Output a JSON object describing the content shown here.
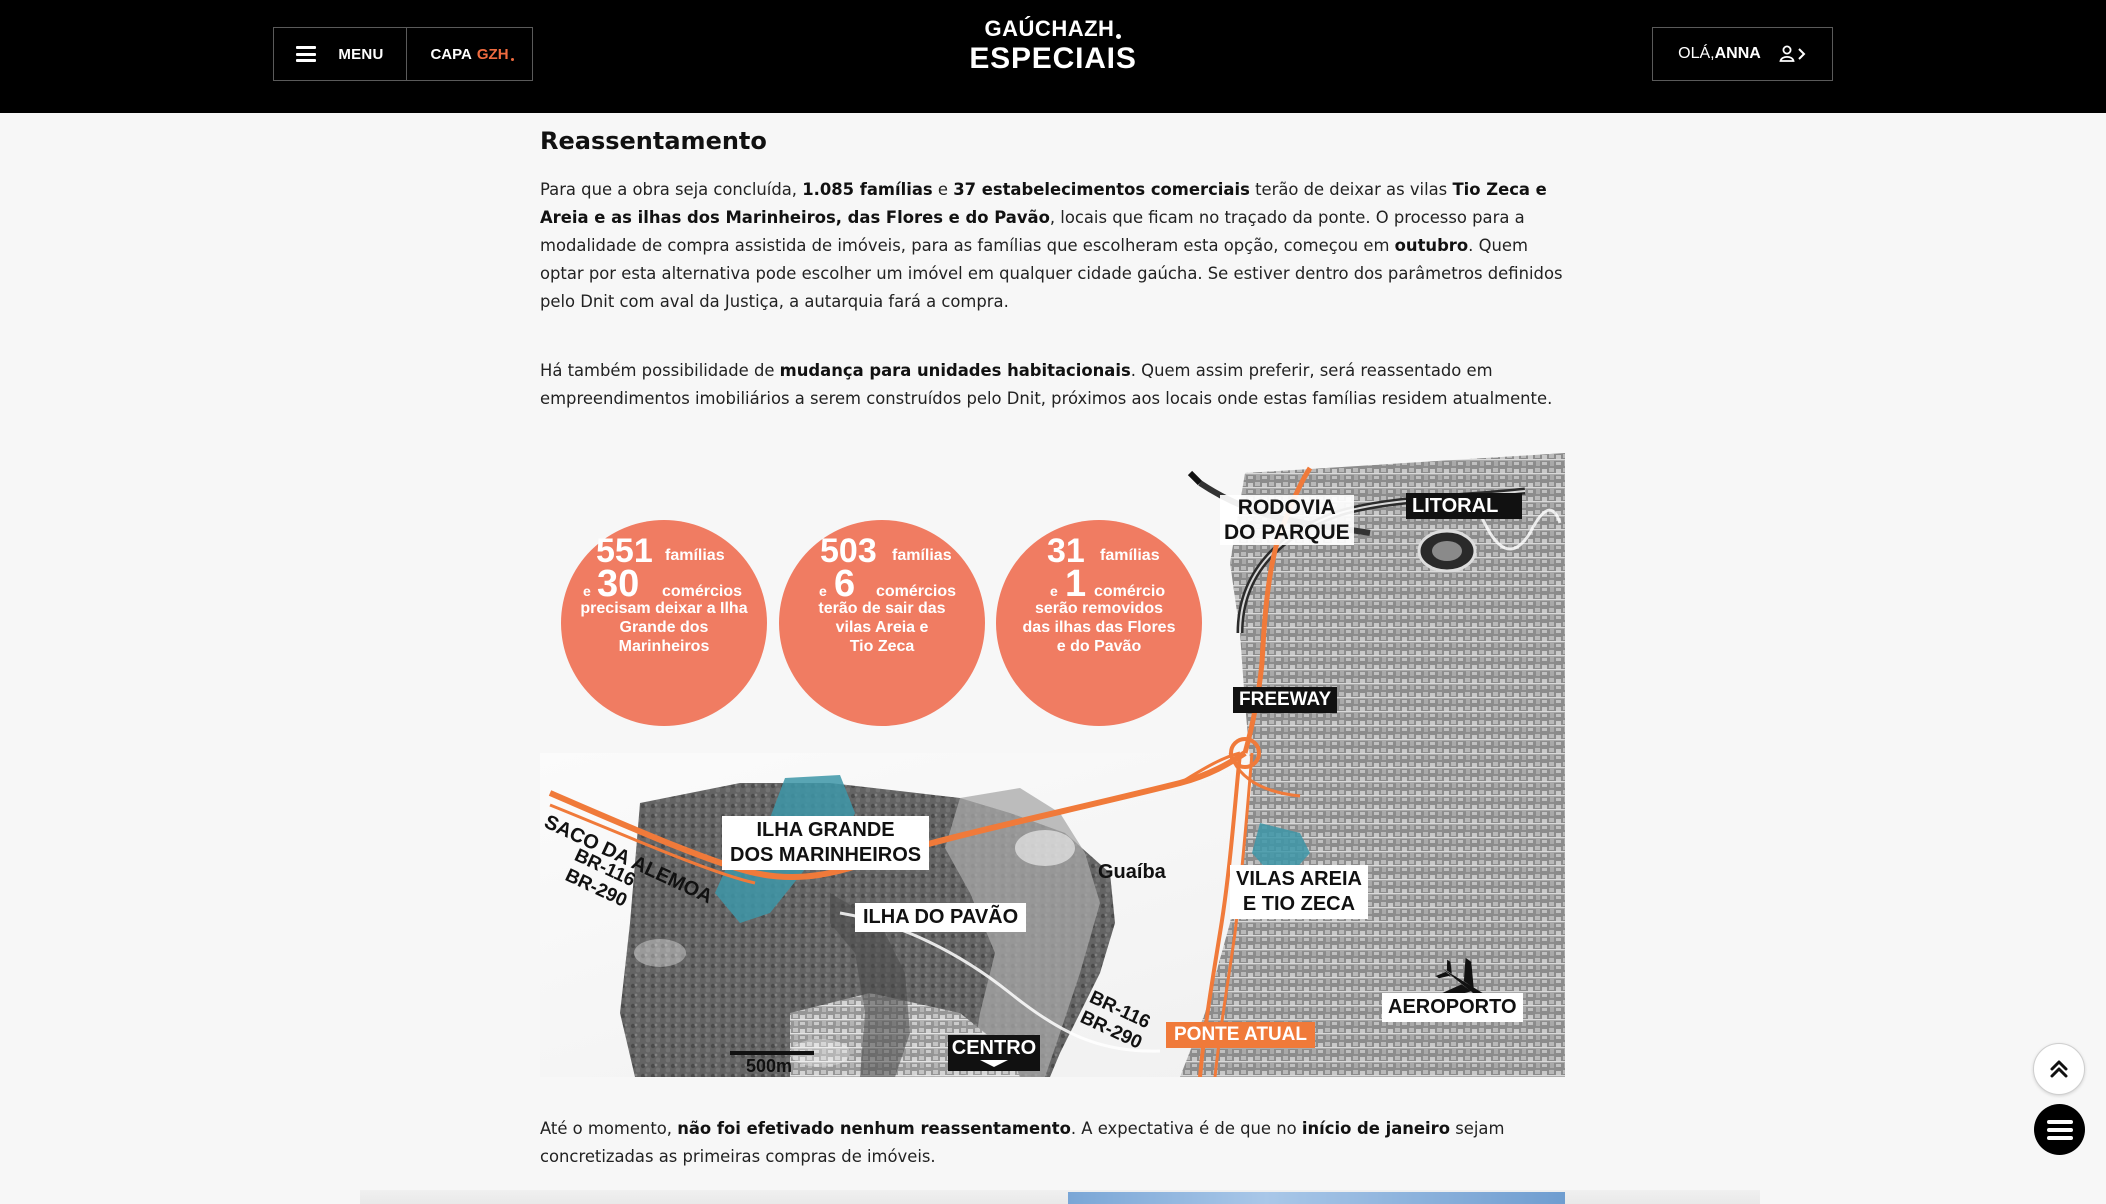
{
  "header": {
    "menu_label": "MENU",
    "capa_prefix": "CAPA",
    "capa_brand": "GZH",
    "logo_top": "GAÚCHAZH",
    "logo_bottom": "ESPECIAIS",
    "greeting": "OLÁ,",
    "user_name": "ANNA"
  },
  "article": {
    "heading": "Reassentamento",
    "p1": {
      "t1": "Para que a obra seja concluída, ",
      "b1": "1.085 famílias",
      "t2": " e ",
      "b2": "37 estabelecimentos comerciais",
      "t3": " terão de deixar as vilas ",
      "b3": "Tio Zeca e Areia e as ilhas dos Marinheiros, das Flores e do Pavão",
      "t4": ", locais que ficam no traçado da ponte. O processo para a modalidade de compra assistida de imóveis, para as famílias que escolheram esta opção, começou em ",
      "b4": "outubro",
      "t5": ". Quem optar por esta alternativa pode escolher um imóvel em qualquer cidade gaúcha. Se estiver dentro dos parâmetros definidos pelo Dnit com aval da Justiça, a autarquia fará a compra."
    },
    "p2": {
      "t1": "Há também possibilidade de ",
      "b1": "mudança para unidades habitacionais",
      "t2": ". Quem assim preferir, será reassentado em empreendimentos imobiliários a serem construídos pelo Dnit, próximos aos locais onde estas famílias residem atualmente."
    },
    "p3": {
      "t1": "Até o momento, ",
      "b1": "não foi efetivado nenhum reassentamento",
      "t2": ". A expectativa é de que no ",
      "b2": "início de janeiro",
      "t3": " sejam concretizadas as primeiras compras de imóveis."
    }
  },
  "infographic": {
    "circles": [
      {
        "n1": "551",
        "w1": "famílias",
        "e": "e",
        "n2": "30",
        "w2": "comércios",
        "line1": "precisam deixar a Ilha",
        "line2": "Grande dos",
        "line3": "Marinheiros"
      },
      {
        "n1": "503",
        "w1": "famílias",
        "e": "e",
        "n2": "6",
        "w2": "comércios",
        "line1": "terão de sair das",
        "line2": "vilas Areia e",
        "line3": "Tio Zeca"
      },
      {
        "n1": "31",
        "w1": "famílias",
        "e": "e",
        "n2": "1",
        "w2": "comércio",
        "line1": "serão removidos",
        "line2": "das ilhas das Flores",
        "line3": "e do Pavão"
      }
    ],
    "labels": {
      "rodovia_1": "RODOVIA",
      "rodovia_2": "DO PARQUE",
      "litoral": "LITORAL",
      "freeway": "FREEWAY",
      "saco": "SACO DA ALEMOA",
      "br116_left": "BR-116",
      "br290_left": "BR-290",
      "ilha_grande_1": "ILHA GRANDE",
      "ilha_grande_2": "DOS MARINHEIROS",
      "guaiba": "Guaíba",
      "vilas_1": "VILAS AREIA",
      "vilas_2": "E TIO ZECA",
      "ilha_pavao": "ILHA DO PAVÃO",
      "aeroporto": "AEROPORTO",
      "br116_right": "BR-116",
      "br290_right": "BR-290",
      "ponte_atual": "PONTE ATUAL",
      "centro": "CENTRO",
      "scale": "500m"
    },
    "colors": {
      "circle": "#f07c62",
      "route": "#f07a3a",
      "area": "#3d97a8"
    }
  }
}
